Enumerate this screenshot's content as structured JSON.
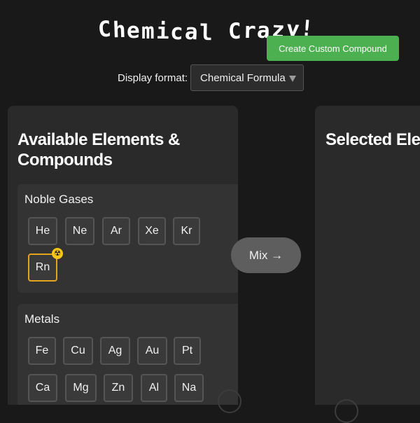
{
  "header": {
    "title": "Chemical Crazy!",
    "create_button": "Create Custom Compound"
  },
  "format": {
    "label": "Display format:",
    "selected": "Chemical Formula"
  },
  "left_panel": {
    "heading": "Available Elements & Compounds",
    "groups": [
      {
        "title": "Noble Gases",
        "elements": [
          "He",
          "Ne",
          "Ar",
          "Xe",
          "Kr",
          "Rn"
        ]
      },
      {
        "title": "Metals",
        "elements": [
          "Fe",
          "Cu",
          "Ag",
          "Au",
          "Pt",
          "Ca",
          "Mg",
          "Zn",
          "Al",
          "Na"
        ]
      }
    ]
  },
  "mix_button": "Mix →",
  "right_panel": {
    "heading": "Selected Elements"
  },
  "colors": {
    "background": "#191919",
    "panel": "#2a2a2a",
    "accent_green": "#4caf50",
    "radioactive_border": "#e2a51b"
  },
  "icons": {
    "radioactive": "radioactive-icon",
    "dropdown": "chevron-down-icon"
  }
}
